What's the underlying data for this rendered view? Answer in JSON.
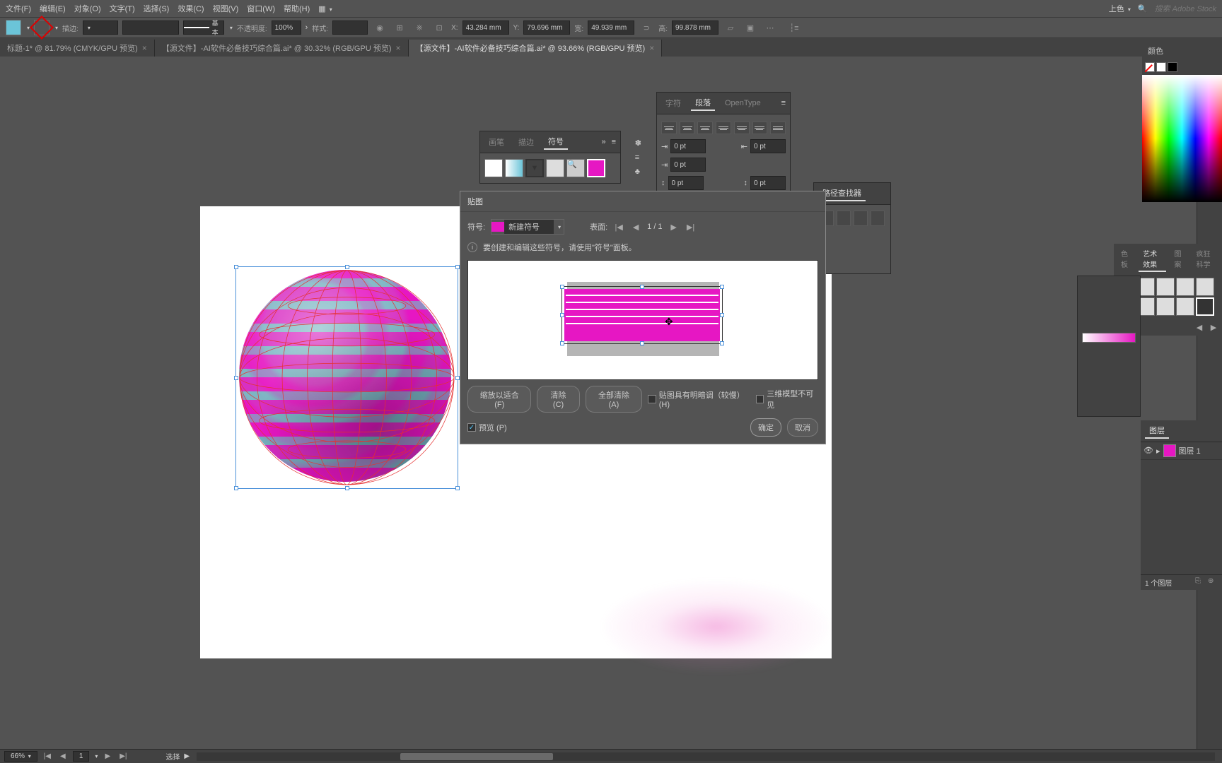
{
  "menu": {
    "file": "文件(F)",
    "edit": "编辑(E)",
    "object": "对象(O)",
    "text": "文字(T)",
    "select": "选择(S)",
    "effect": "效果(C)",
    "view": "视图(V)",
    "window": "窗口(W)",
    "help": "帮助(H)",
    "recolor": "上色",
    "search_placeholder": "搜索 Adobe Stock"
  },
  "controlbar": {
    "stroke_label": "描边:",
    "stroke_style": "基本",
    "opacity_label": "不透明度:",
    "opacity_value": "100%",
    "style_label": "样式:",
    "x_label": "X:",
    "x_value": "43.284 mm",
    "y_label": "Y:",
    "y_value": "79.696 mm",
    "w_label": "宽:",
    "w_value": "49.939 mm",
    "h_label": "高:",
    "h_value": "99.878 mm"
  },
  "tabs": {
    "t1": "标题-1* @ 81.79% (CMYK/GPU 预览)",
    "t2": "【源文件】-AI软件必备技巧综合篇.ai* @ 30.32% (RGB/GPU 预览)",
    "t3": "【源文件】-AI软件必备技巧综合篇.ai* @ 93.66% (RGB/GPU 预览)"
  },
  "panels": {
    "symbols": {
      "brush": "画笔",
      "stroke": "描边",
      "symbol": "符号"
    },
    "paragraph": {
      "char": "字符",
      "para": "段落",
      "opentype": "OpenType",
      "indent_val": "0 pt"
    },
    "pathfinder": {
      "title": "路径查找器"
    },
    "color": {
      "title": "颜色"
    },
    "swatches": {
      "t1": "色板",
      "t2": "艺术效果",
      "t3": "图案",
      "t4": "疯狂科学"
    },
    "layers": {
      "title": "图层",
      "layer1": "图层 1",
      "footer": "1 个图层"
    }
  },
  "dialog": {
    "title": "贴图",
    "symbol_label": "符号:",
    "symbol_selected": "新建符号",
    "surface_label": "表面:",
    "surface_value": "1 / 1",
    "info_text": "要创建和编辑这些符号，请使用\"符号\"面板。",
    "scale_fit": "缩放以适合 (F)",
    "clear": "清除 (C)",
    "clear_all": "全部清除 (A)",
    "shade_artwork": "贴图具有明暗调（较慢）(H)",
    "invisible_geometry": "三维模型不可见",
    "preview": "预览 (P)",
    "ok": "确定",
    "cancel": "取消"
  },
  "status": {
    "zoom": "66%",
    "page": "1",
    "tool": "选择"
  }
}
